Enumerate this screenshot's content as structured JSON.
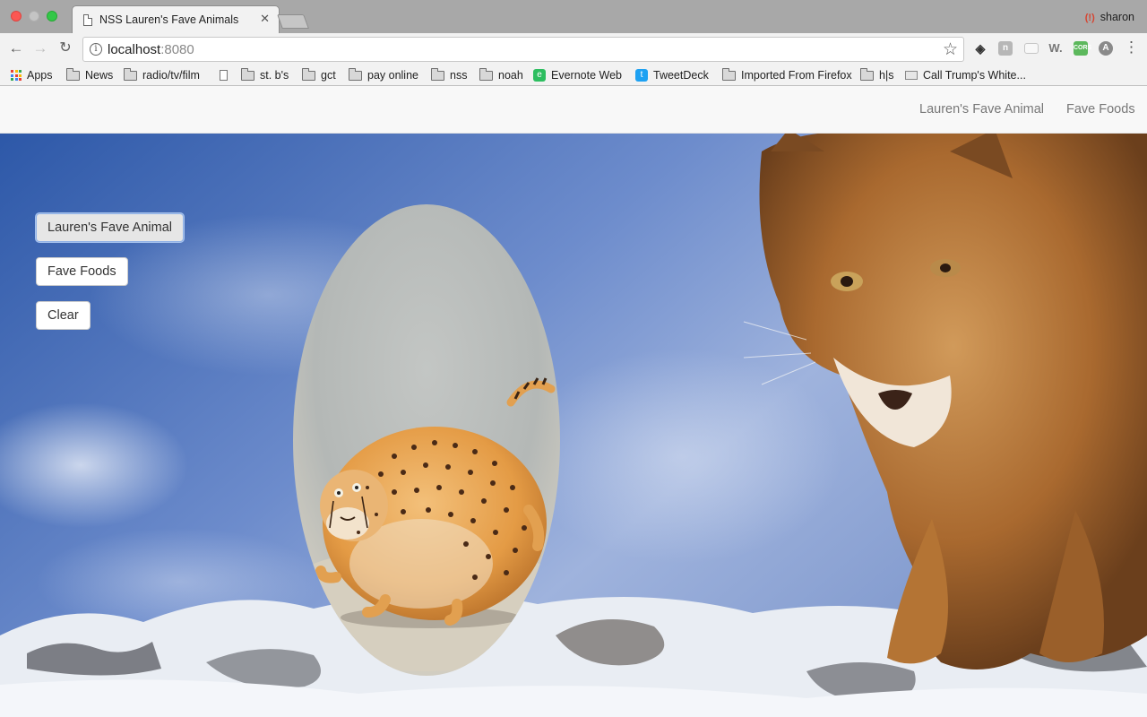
{
  "browser": {
    "tab_title": "NSS Lauren's Fave Animals",
    "tab_close": "✕",
    "profile_name": "sharon",
    "url_host": "localhost",
    "url_port": ":8080",
    "nav": {
      "back": "←",
      "forward": "→",
      "reload": "↻"
    },
    "star": "☆",
    "menu": "⋮",
    "extensions": {
      "w": "W.",
      "cors": "CORS",
      "a": "A"
    },
    "bookmarks": [
      {
        "label": "Apps",
        "icon": "apps-grid-icon"
      },
      {
        "label": "News",
        "icon": "folder-icon"
      },
      {
        "label": "radio/tv/film",
        "icon": "folder-icon"
      },
      {
        "label": "",
        "icon": "page-icon"
      },
      {
        "label": "st. b's",
        "icon": "folder-icon"
      },
      {
        "label": "gct",
        "icon": "folder-icon"
      },
      {
        "label": "pay online",
        "icon": "folder-icon"
      },
      {
        "label": "nss",
        "icon": "folder-icon"
      },
      {
        "label": "noah",
        "icon": "folder-icon"
      },
      {
        "label": "Evernote Web",
        "icon": "evernote-icon"
      },
      {
        "label": "TweetDeck",
        "icon": "tweetdeck-icon"
      },
      {
        "label": "Imported From Firefox",
        "icon": "folder-icon"
      },
      {
        "label": "h|s",
        "icon": "folder-icon"
      },
      {
        "label": "Call Trump's White...",
        "icon": "whitehouse-icon"
      }
    ]
  },
  "navbar": {
    "link_animal": "Lauren's Fave Animal",
    "link_foods": "Fave Foods"
  },
  "buttons": {
    "animal": "Lauren's Fave Animal",
    "foods": "Fave Foods",
    "clear": "Clear"
  },
  "images": {
    "background": "mountain-lion-in-snow",
    "oval": "round-cheetah-cartoon"
  },
  "colors": {
    "sky": "#4a6fb8",
    "snow": "#e8ecf2",
    "puma": "#b5763a",
    "cheetah": "#e8a44c",
    "button_focus": "#8fb1e6"
  }
}
